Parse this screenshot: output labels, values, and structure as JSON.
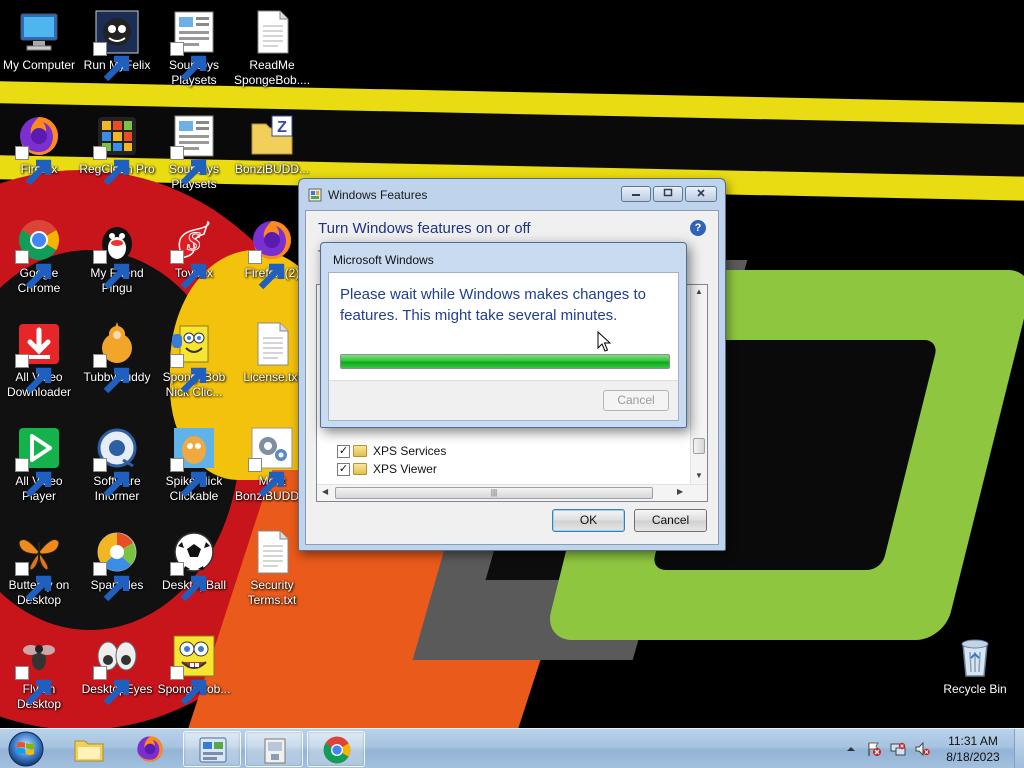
{
  "desktop": {
    "icons": [
      {
        "label": "My Computer",
        "icon": "computer-icon"
      },
      {
        "label": "Run MyFelix",
        "icon": "felix-icon"
      },
      {
        "label": "Souptoys Playsets",
        "icon": "playsets-icon"
      },
      {
        "label": "ReadMe SpongeBob....",
        "icon": "document-icon"
      },
      {
        "label": "Firefox",
        "icon": "firefox-icon"
      },
      {
        "label": "RegClean Pro",
        "icon": "regclean-icon"
      },
      {
        "label": "Souptoys Playsets",
        "icon": "playsets-icon"
      },
      {
        "label": "BonziBUDD...",
        "icon": "zip-folder-icon"
      },
      {
        "label": "Google Chrome",
        "icon": "chrome-icon"
      },
      {
        "label": "My Friend Pingu",
        "icon": "pingu-icon"
      },
      {
        "label": "Toybox",
        "icon": "toybox-icon"
      },
      {
        "label": "Firefox (2)",
        "icon": "firefox-icon"
      },
      {
        "label": "All Video Downloader",
        "icon": "downloader-icon"
      },
      {
        "label": "TubbyBuddy",
        "icon": "tubbybuddy-icon"
      },
      {
        "label": "SpongeBob Nick Clic...",
        "icon": "spongebob-icon"
      },
      {
        "label": "License.txt",
        "icon": "document-icon"
      },
      {
        "label": "All Video Player",
        "icon": "video-player-icon"
      },
      {
        "label": "Software Informer",
        "icon": "software-informer-icon"
      },
      {
        "label": "Spike Nick Clickable",
        "icon": "spike-icon"
      },
      {
        "label": "Meet BonziBUDD...",
        "icon": "gear-icon"
      },
      {
        "label": "Butterfly on Desktop",
        "icon": "butterfly-icon"
      },
      {
        "label": "Sparticles",
        "icon": "sparticles-icon"
      },
      {
        "label": "DesktopBall",
        "icon": "soccer-ball-icon"
      },
      {
        "label": "Security Terms.txt",
        "icon": "document-icon"
      },
      {
        "label": "Fly on Desktop",
        "icon": "fly-icon"
      },
      {
        "label": "DesktopEyes",
        "icon": "eyes-icon"
      },
      {
        "label": "SpongeBob...",
        "icon": "spongebob-face-icon"
      },
      {
        "label": "Recycle Bin",
        "icon": "recycle-bin-icon"
      }
    ]
  },
  "features_dialog": {
    "title": "Windows Features",
    "heading": "Turn Windows features on or off",
    "desc_partial": "T",
    "desc_tail": ".",
    "features": [
      {
        "label": "XPS Services",
        "checked": true
      },
      {
        "label": "XPS Viewer",
        "checked": true
      }
    ],
    "ok_label": "OK",
    "cancel_label": "Cancel",
    "help_glyph": "?"
  },
  "progress_dialog": {
    "title": "Microsoft Windows",
    "message": "Please wait while Windows makes changes to features. This might take several minutes.",
    "progress": 1.0,
    "cancel_label": "Cancel",
    "cancel_enabled": false
  },
  "taskbar": {
    "pinned": [
      {
        "icon": "explorer-folder-icon",
        "active": false
      },
      {
        "icon": "firefox-icon",
        "active": false
      },
      {
        "icon": "control-panel-icon",
        "active": true
      },
      {
        "icon": "installer-icon",
        "active": true
      },
      {
        "icon": "chrome-icon",
        "active": true
      }
    ],
    "clock_time": "11:31 AM",
    "clock_date": "8/18/2023"
  },
  "colors": {
    "progress_green": "#16b41f",
    "dialog_text_blue": "#1f3f8f",
    "taskbar": "#a6c3e0"
  }
}
